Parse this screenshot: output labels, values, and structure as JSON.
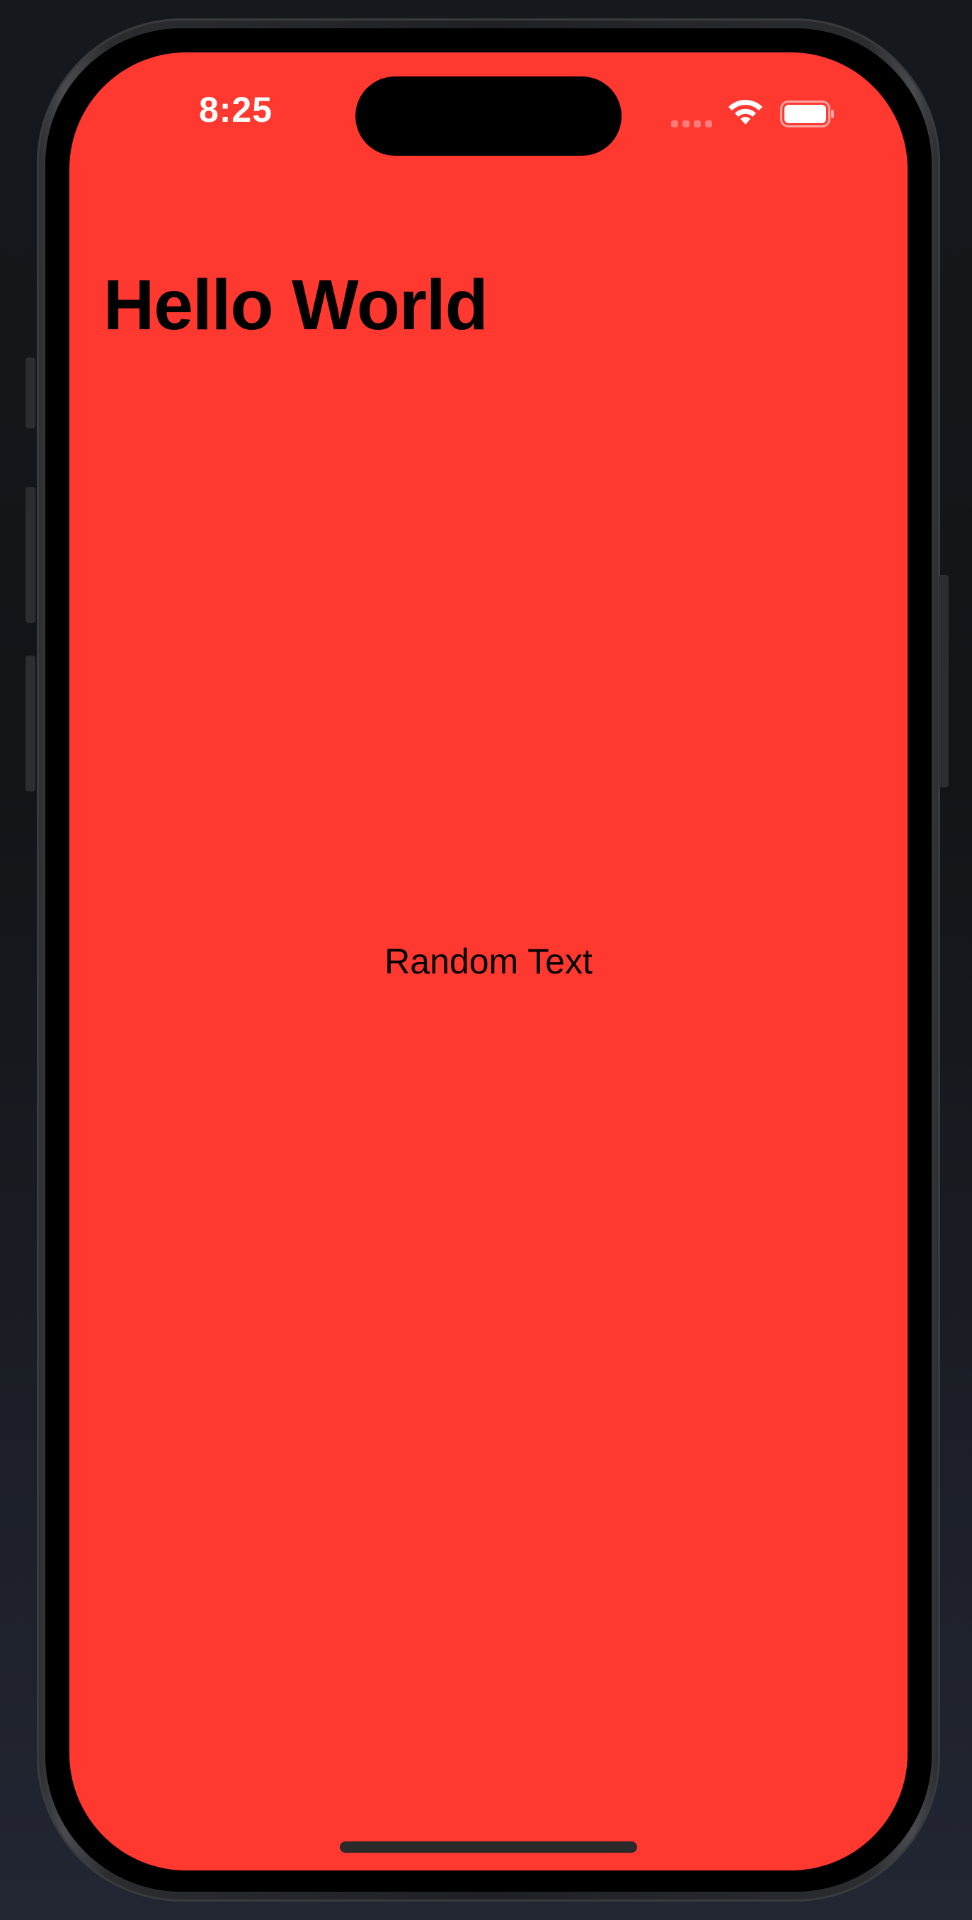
{
  "status_bar": {
    "time": "8:25",
    "icons": [
      "cellular-signal-icon",
      "wifi-icon",
      "battery-icon"
    ]
  },
  "screen": {
    "title": "Hello World",
    "body_text": "Random Text"
  },
  "colors": {
    "background": "#ff3830",
    "text": "#000000",
    "status_text": "#ffffff"
  }
}
